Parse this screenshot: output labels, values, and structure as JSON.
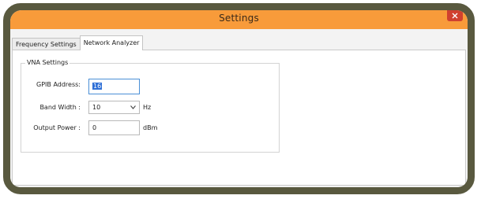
{
  "window": {
    "title": "Settings",
    "titlebar_color": "#f89b3a",
    "frame_color": "#59593f",
    "close_color": "#d0402f"
  },
  "tabs": [
    {
      "label": "Frequency Settings",
      "active": false
    },
    {
      "label": "Network Analyzer",
      "active": true
    }
  ],
  "vna_settings": {
    "group_title": "VNA Settings",
    "gpib": {
      "label": "GPIB Address:",
      "value": "16"
    },
    "bandwidth": {
      "label": "Band Width :",
      "value": "10",
      "unit": "Hz"
    },
    "output_power": {
      "label": "Output Power :",
      "value": "0",
      "unit": "dBm"
    }
  }
}
